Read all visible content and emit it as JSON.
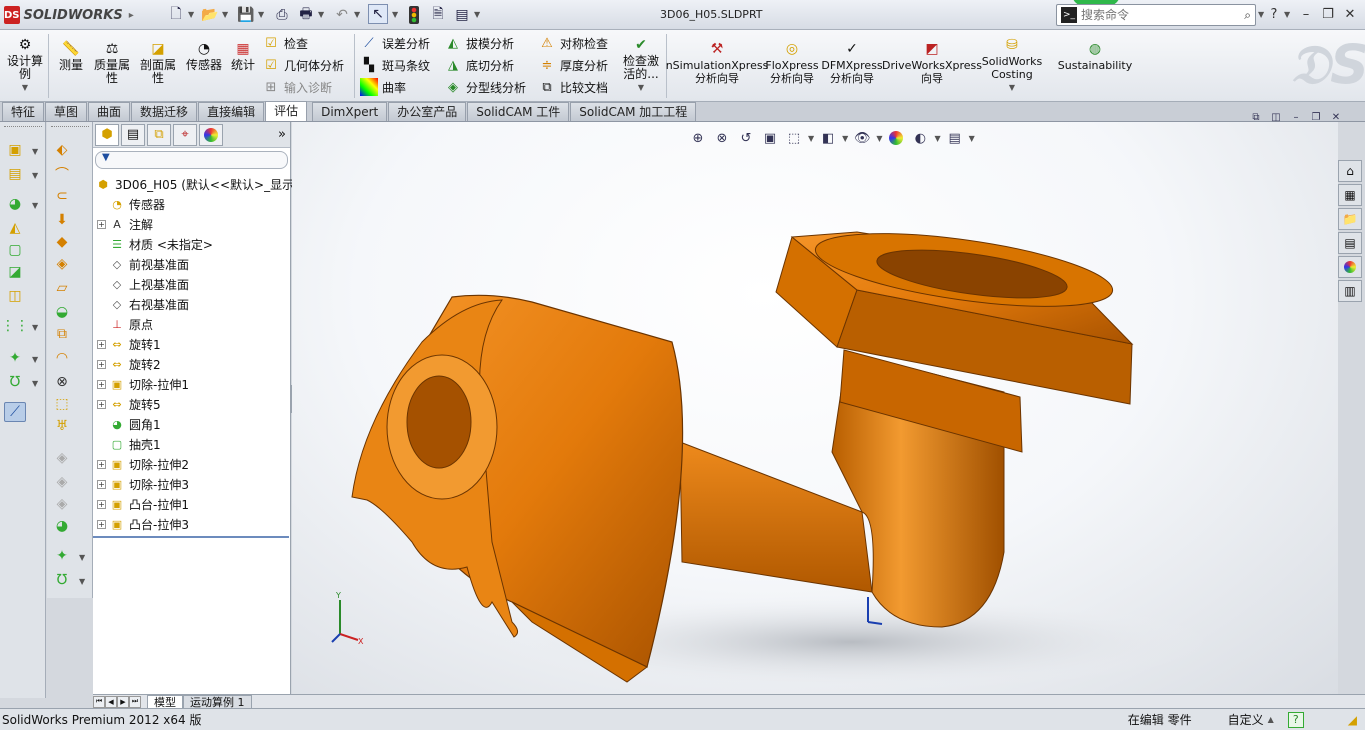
{
  "app": {
    "brand": "SOLIDWORKS",
    "doc_title": "3D06_H05.SLDPRT"
  },
  "search": {
    "placeholder": "搜索命令"
  },
  "ribbon": {
    "design_study": "设计算例",
    "measure": "测量",
    "mass_props": "质量属性",
    "section_props": "剖面属性",
    "sensors": "传感器",
    "statistics": "统计",
    "check": "检查",
    "geometry_analysis": "几何体分析",
    "import_diagnostics": "输入诊断",
    "deviation_analysis": "误差分析",
    "zebra_stripes": "斑马条纹",
    "curvature": "曲率",
    "draft_analysis": "拔模分析",
    "undercut_analysis": "底切分析",
    "parting_line_analysis": "分型线分析",
    "symmetry_check": "对称检查",
    "thickness_analysis": "厚度分析",
    "compare_documents": "比较文档",
    "check_active": "检查激活的...",
    "simulation_xpress": "nSimulationXpress\n分析向导",
    "flo_xpress": "FloXpress\n分析向导",
    "dfm_xpress": "DFMXpress\n分析向导",
    "driveworks_xpress": "DriveWorksXpress\n向导",
    "sw_costing": "SolidWorks\nCosting",
    "sustainability": "Sustainability"
  },
  "tabs": [
    "特征",
    "草图",
    "曲面",
    "数据迁移",
    "直接编辑",
    "评估",
    "DimXpert",
    "办公室产品",
    "SolidCAM 工件",
    "SolidCAM 加工工程"
  ],
  "tree": {
    "root": "3D06_H05  (默认<<默认>_显示",
    "nodes": [
      {
        "label": "传感器",
        "icon": "sensor-icon",
        "expandable": false
      },
      {
        "label": "注解",
        "icon": "annotation-icon",
        "expandable": true
      },
      {
        "label": "材质 <未指定>",
        "icon": "material-icon",
        "expandable": false
      },
      {
        "label": "前视基准面",
        "icon": "plane-icon",
        "expandable": false
      },
      {
        "label": "上视基准面",
        "icon": "plane-icon",
        "expandable": false
      },
      {
        "label": "右视基准面",
        "icon": "plane-icon",
        "expandable": false
      },
      {
        "label": "原点",
        "icon": "origin-icon",
        "expandable": false
      },
      {
        "label": "旋转1",
        "icon": "revolve-icon",
        "expandable": true
      },
      {
        "label": "旋转2",
        "icon": "revolve-icon",
        "expandable": true
      },
      {
        "label": "切除-拉伸1",
        "icon": "cut-extrude-icon",
        "expandable": true
      },
      {
        "label": "旋转5",
        "icon": "revolve-icon",
        "expandable": true
      },
      {
        "label": "圆角1",
        "icon": "fillet-icon",
        "expandable": false
      },
      {
        "label": "抽壳1",
        "icon": "shell-icon",
        "expandable": false
      },
      {
        "label": "切除-拉伸2",
        "icon": "cut-extrude-icon",
        "expandable": true
      },
      {
        "label": "切除-拉伸3",
        "icon": "cut-extrude-icon",
        "expandable": true
      },
      {
        "label": "凸台-拉伸1",
        "icon": "boss-extrude-icon",
        "expandable": true
      },
      {
        "label": "凸台-拉伸3",
        "icon": "boss-extrude-icon",
        "expandable": true
      }
    ]
  },
  "bottom_tabs": {
    "model": "模型",
    "motion": "运动算例 1"
  },
  "status": {
    "version": "SolidWorks Premium 2012 x64 版",
    "editing": "在编辑 零件",
    "units": "自定义"
  },
  "colors": {
    "part": "#E37A0B",
    "accent": "#1a3fb0"
  }
}
